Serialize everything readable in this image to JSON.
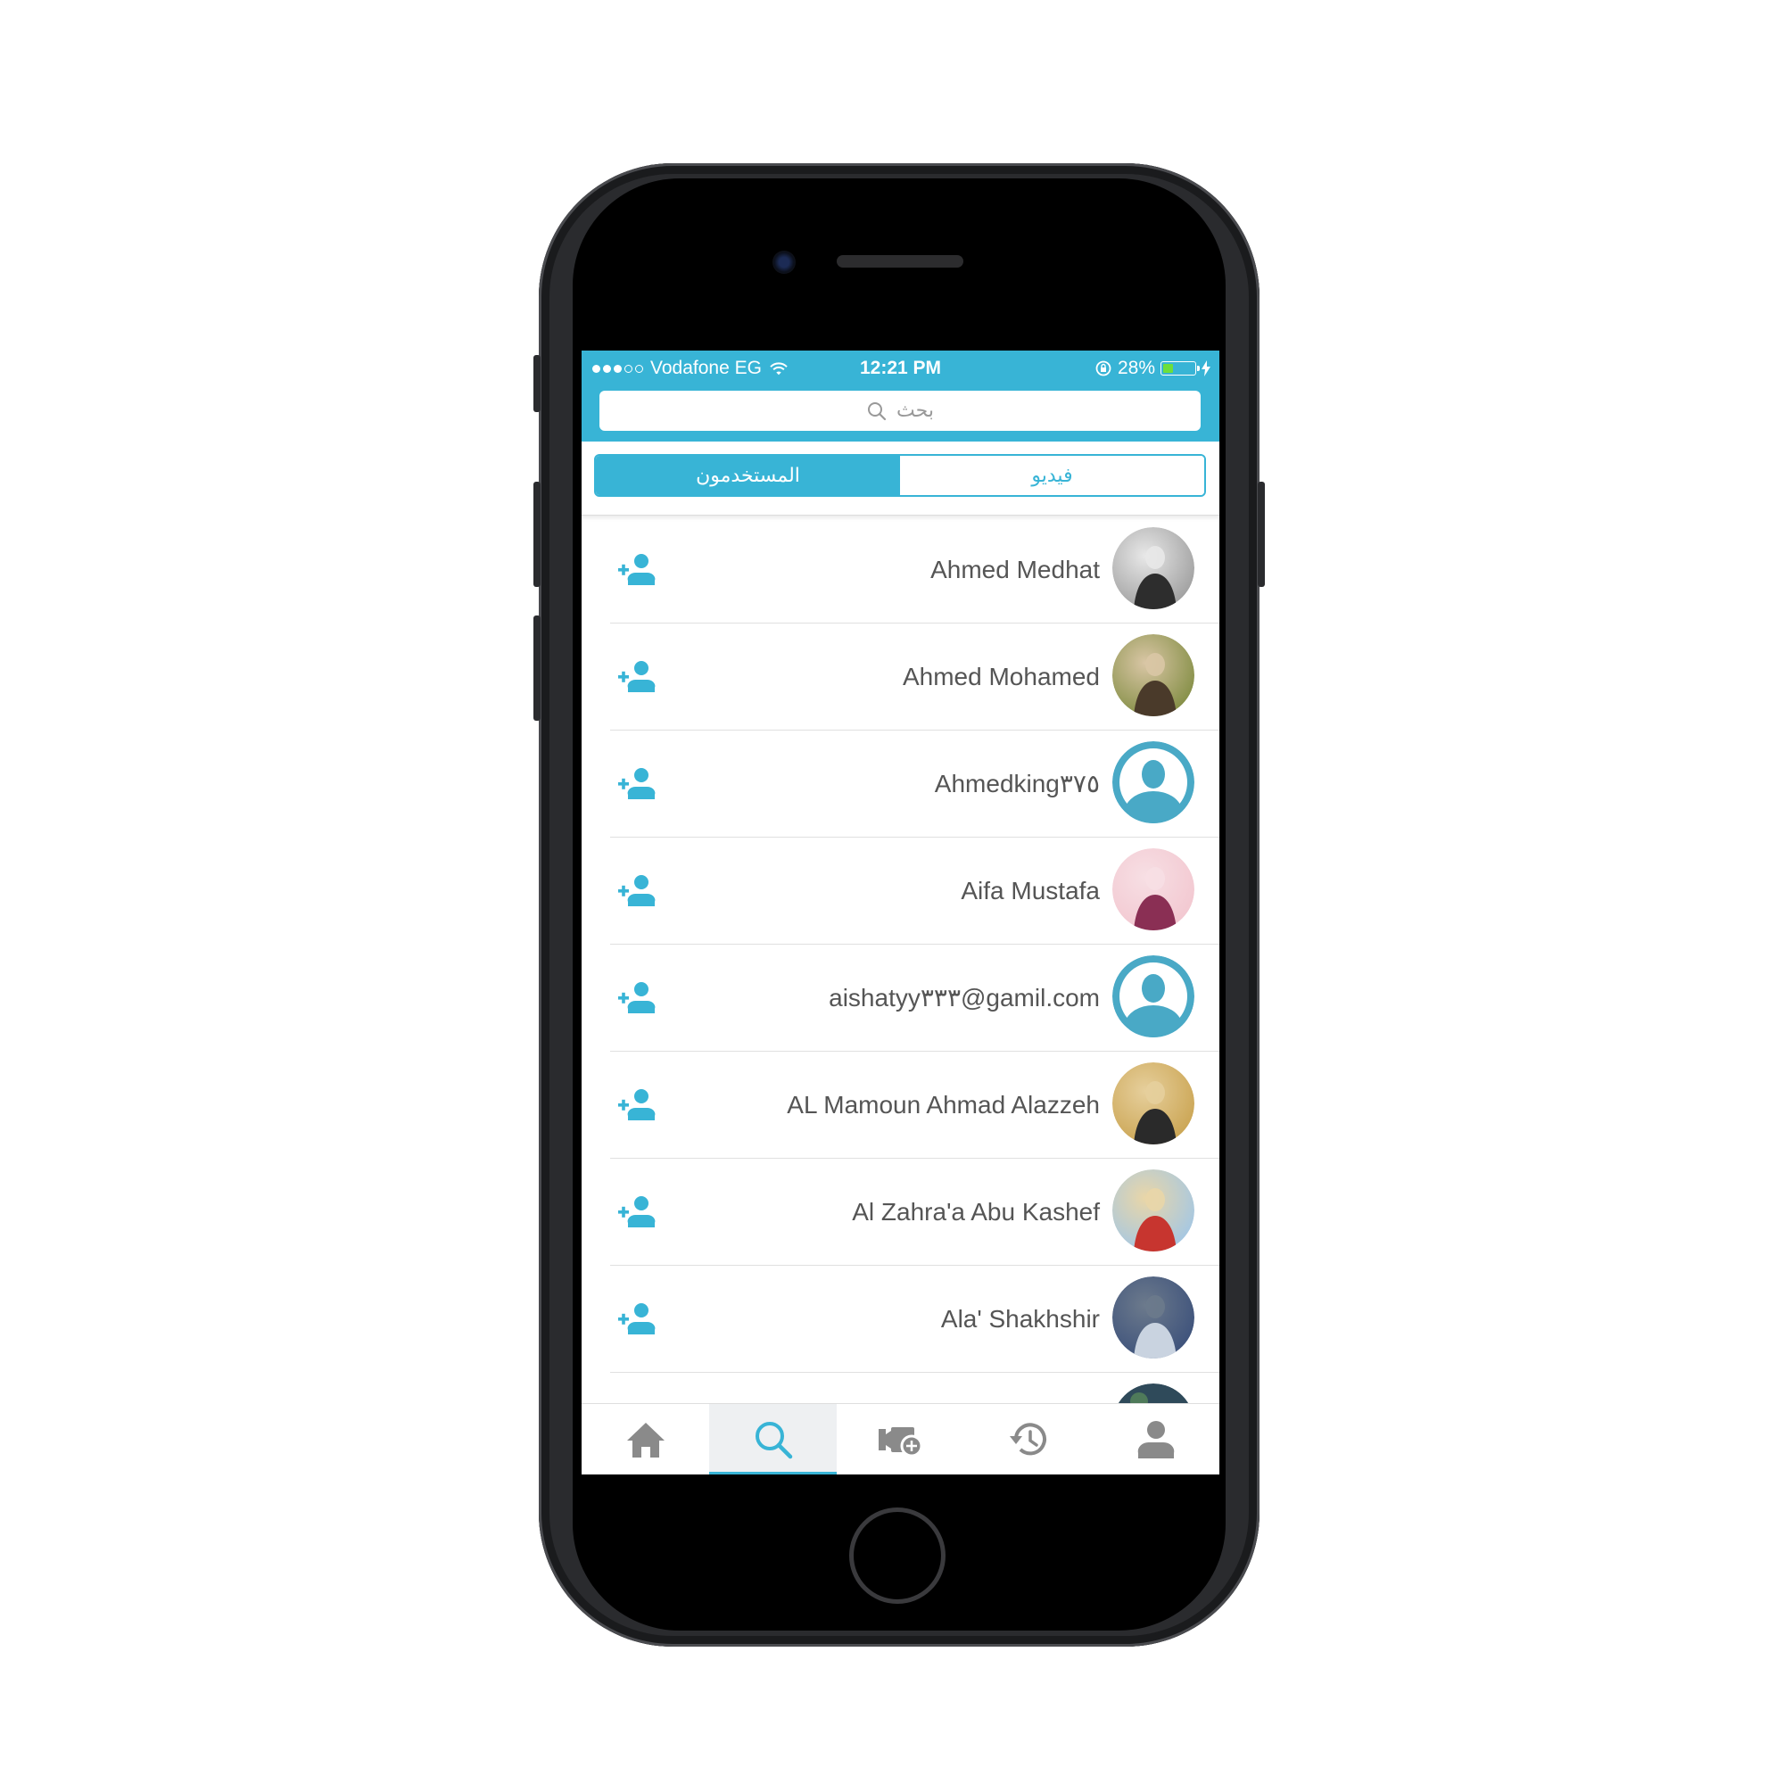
{
  "status_bar": {
    "carrier": "Vodafone EG",
    "time": "12:21 PM",
    "battery_percent": "28%",
    "battery_level": 0.28,
    "signal_bars_filled": 3,
    "signal_bars_total": 5,
    "icons": [
      "wifi-icon",
      "orientation-lock-icon",
      "battery-icon",
      "charging-bolt-icon"
    ]
  },
  "search": {
    "placeholder": "بحث"
  },
  "segments": {
    "users_label": "المستخدمون",
    "video_label": "فيديو",
    "selected": "users"
  },
  "users": [
    {
      "name": "Ahmed Medhat",
      "avatar": "photo"
    },
    {
      "name": "Ahmed Mohamed",
      "avatar": "photo"
    },
    {
      "name": "Ahmedking٣٧٥",
      "avatar": "default"
    },
    {
      "name": "Aifa Mustafa",
      "avatar": "photo"
    },
    {
      "name": "aishatyy٣٣٣@gamil.com",
      "avatar": "default"
    },
    {
      "name": "AL Mamoun Ahmad Alazzeh",
      "avatar": "photo"
    },
    {
      "name": "Al Zahra'a Abu Kashef",
      "avatar": "photo"
    },
    {
      "name": "Ala' Shakhshir",
      "avatar": "photo"
    }
  ],
  "tabbar": {
    "items": [
      "home-icon",
      "search-icon",
      "add-video-icon",
      "history-icon",
      "profile-icon"
    ],
    "active": "search-icon"
  },
  "colors": {
    "accent": "#38b4d6",
    "icon_gray": "#8a8a8a",
    "text": "#555555",
    "default_avatar": "#49a9c6"
  }
}
